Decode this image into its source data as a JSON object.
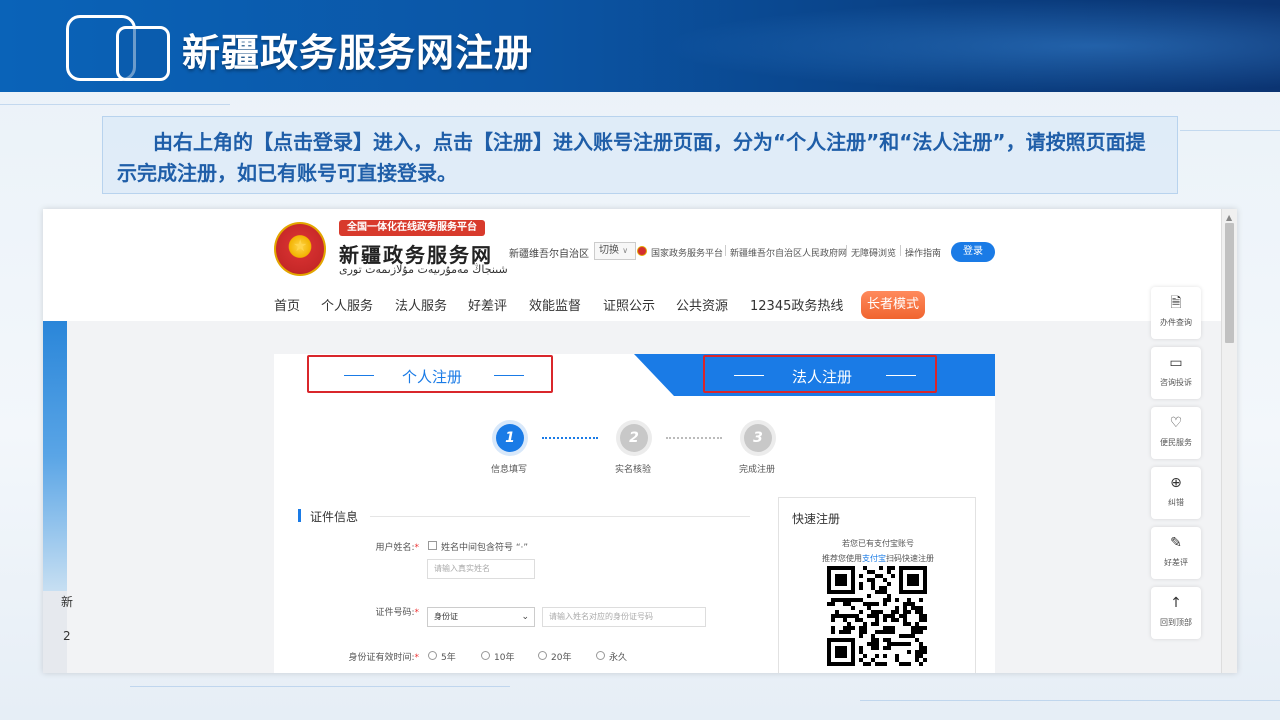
{
  "slide": {
    "title": "新疆政务服务网注册",
    "instruction": "由右上角的【点击登录】进入，点击【注册】进入账号注册页面，分为“个人注册”和“法人注册”，请按照页面提示完成注册，如已有账号可直接登录。"
  },
  "header": {
    "platform_tag": "全国一体化在线政务服务平台",
    "site_name": "新疆政务服务网",
    "site_name_uyghur": "شىنجاڭ مەمۇرىيەت مۇلازىمەت تورى",
    "region": "新疆维吾尔自治区",
    "switch_label": "切换",
    "links": [
      "国家政务服务平台",
      "新疆维吾尔自治区人民政府网",
      "无障碍浏览",
      "操作指南"
    ],
    "login_label": "登录"
  },
  "nav": {
    "items": [
      "首页",
      "个人服务",
      "法人服务",
      "好差评",
      "效能监督",
      "证照公示",
      "公共资源",
      "12345政务热线"
    ],
    "elder_mode": "长者模式"
  },
  "left_partial": {
    "char1": "新",
    "char2": "2"
  },
  "tabs": {
    "personal": "个人注册",
    "legal": "法人注册"
  },
  "steps": [
    {
      "num": "1",
      "label": "信息填写",
      "active": true
    },
    {
      "num": "2",
      "label": "实名核验",
      "active": false
    },
    {
      "num": "3",
      "label": "完成注册",
      "active": false
    }
  ],
  "form": {
    "section_title": "证件信息",
    "username_label": "用户姓名:",
    "dot_checkbox_label": "姓名中间包含符号 “·”",
    "username_placeholder": "请输入真实姓名",
    "id_label": "证件号码:",
    "id_type": "身份证",
    "id_placeholder": "请输入姓名对应的身份证号码",
    "validity_label": "身份证有效时间:",
    "validity_options": [
      "5年",
      "10年",
      "20年",
      "永久"
    ]
  },
  "quick_register": {
    "title": "快速注册",
    "line1": "若您已有支付宝账号",
    "line2_prefix": "推荐您使用",
    "line2_alipay": "支付宝",
    "line2_suffix": "扫码快速注册"
  },
  "float_toolbar": [
    {
      "icon": "document-search-icon",
      "label": "办件查询"
    },
    {
      "icon": "chat-icon",
      "label": "咨询投诉"
    },
    {
      "icon": "heart-service-icon",
      "label": "便民服务"
    },
    {
      "icon": "magnifier-icon",
      "label": "纠错"
    },
    {
      "icon": "edit-review-icon",
      "label": "好差评"
    },
    {
      "icon": "arrow-up-icon",
      "label": "回到顶部"
    }
  ],
  "colors": {
    "brand_blue": "#1a7be6",
    "highlight_red": "#d9262b",
    "elder_orange": "#f0642f",
    "banner_blue": "#0a56a6"
  }
}
